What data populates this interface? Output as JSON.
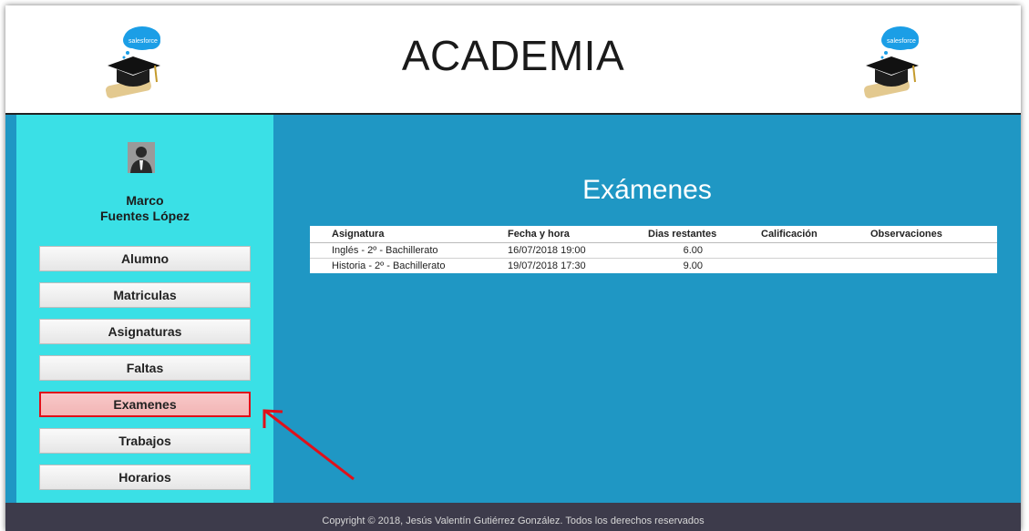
{
  "header": {
    "title": "ACADEMIA"
  },
  "user": {
    "first_name": "Marco",
    "last_name": "Fuentes López"
  },
  "nav": {
    "items": [
      {
        "label": "Alumno",
        "active": false
      },
      {
        "label": "Matriculas",
        "active": false
      },
      {
        "label": "Asignaturas",
        "active": false
      },
      {
        "label": "Faltas",
        "active": false
      },
      {
        "label": "Examenes",
        "active": true
      },
      {
        "label": "Trabajos",
        "active": false
      },
      {
        "label": "Horarios",
        "active": false
      }
    ]
  },
  "main": {
    "heading": "Exámenes",
    "table": {
      "columns": [
        "Asignatura",
        "Fecha y hora",
        "Dias restantes",
        "Calificación",
        "Observaciones"
      ],
      "rows": [
        [
          "Inglés - 2º - Bachillerato",
          "16/07/2018 19:00",
          "6.00",
          "",
          ""
        ],
        [
          "Historia - 2º - Bachillerato",
          "19/07/2018 17:30",
          "9.00",
          "",
          ""
        ]
      ]
    }
  },
  "footer": {
    "copyright": "Copyright © 2018, Jesús Valentín Gutiérrez González. Todos los derechos reservados"
  },
  "colors": {
    "sidebar": "#3ae0e6",
    "main": "#1f97c4",
    "footer": "#3d3b4b",
    "highlight": "#e0101a"
  }
}
